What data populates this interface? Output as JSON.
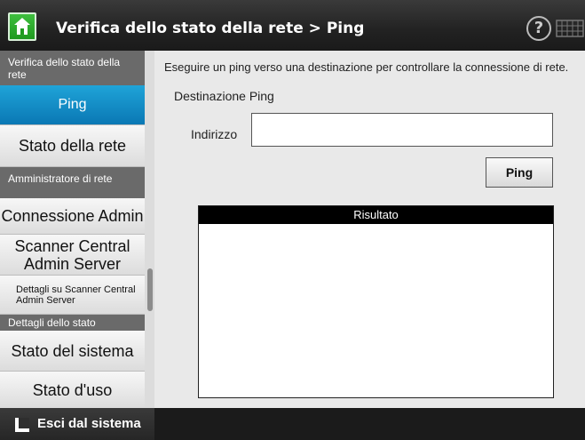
{
  "header": {
    "title": "Verifica dello stato della rete > Ping",
    "home_icon": "home-icon",
    "help_symbol": "?",
    "keyboard_icon": "keyboard-icon"
  },
  "sidebar": {
    "section1": "Verifica dello stato della rete",
    "item_ping": "Ping",
    "item_net_status": "Stato della rete",
    "section2": "Amministratore di rete",
    "item_admin_conn": "Connessione Admin",
    "item_scanner_server": "Scanner Central Admin Server",
    "item_scanner_details": "Dettagli su Scanner Central Admin Server",
    "section3": "Dettagli dello stato",
    "item_system_status": "Stato del sistema",
    "item_usage_status": "Stato d'uso"
  },
  "main": {
    "description": "Eseguire un ping verso una destinazione per controllare la connessione di rete.",
    "destination_label": "Destinazione Ping",
    "address_label": "Indirizzo",
    "address_value": "",
    "ping_button": "Ping",
    "result_header": "Risultato"
  },
  "footer": {
    "logout_label": "Esci dal sistema"
  },
  "colors": {
    "active_item": "#0a78b4",
    "home_green": "#1f9a1f"
  }
}
